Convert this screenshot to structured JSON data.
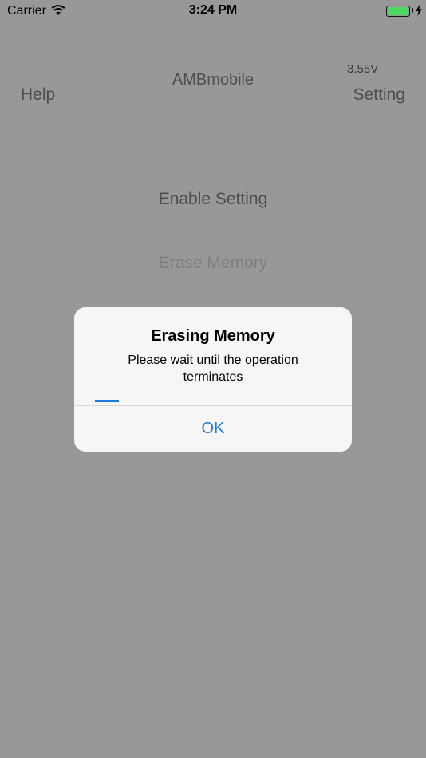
{
  "status_bar": {
    "carrier": "Carrier",
    "time": "3:24 PM",
    "battery_level": 1.0,
    "battery_color": "#4cd964"
  },
  "nav": {
    "help_label": "Help",
    "title": "AMBmobile",
    "voltage": "3.55V",
    "setting_label": "Setting"
  },
  "main": {
    "enable_setting_label": "Enable Setting",
    "erase_memory_label": "Erase Memory"
  },
  "alert": {
    "title": "Erasing Memory",
    "message": "Please wait until the operation terminates",
    "progress": 0.1,
    "ok_label": "OK",
    "accent_color": "#1a7bdc"
  },
  "icons": {
    "wifi": "wifi-icon",
    "battery": "battery-icon",
    "charging": "charging-bolt-icon"
  }
}
